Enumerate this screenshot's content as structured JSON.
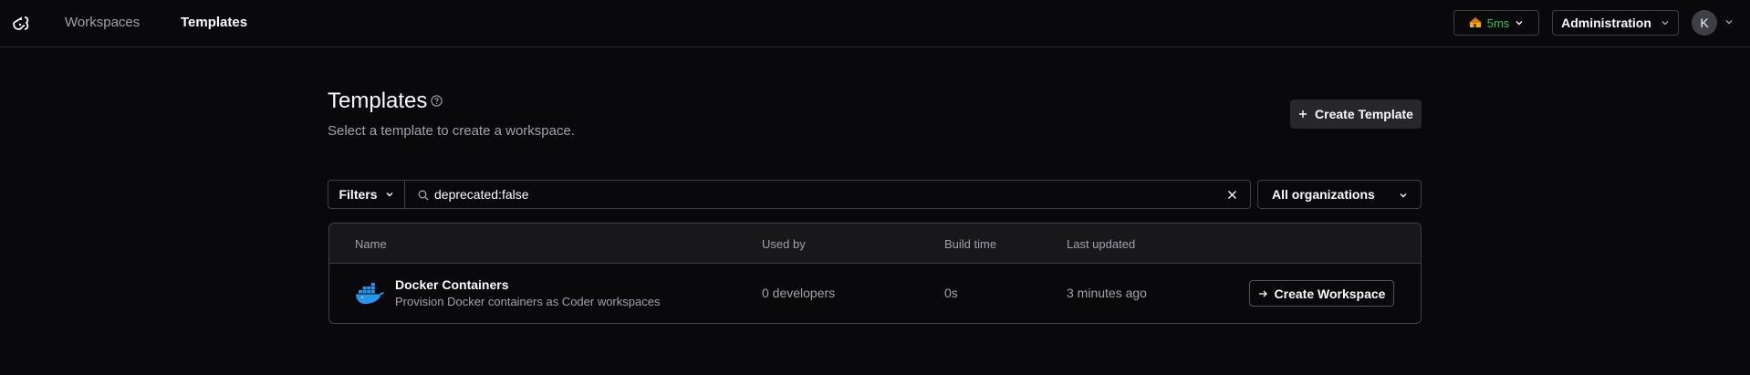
{
  "nav": {
    "logo": "coder-logo",
    "workspaces": "Workspaces",
    "templates": "Templates",
    "latency": "5ms",
    "administration": "Administration",
    "avatar_initial": "K"
  },
  "header": {
    "title": "Templates",
    "subtitle": "Select a template to create a workspace.",
    "create_button": "Create Template"
  },
  "filter": {
    "filters_label": "Filters",
    "search_value": "deprecated:false",
    "org_select": "All organizations"
  },
  "table": {
    "columns": [
      "Name",
      "Used by",
      "Build time",
      "Last updated"
    ],
    "rows": [
      {
        "icon": "docker-icon",
        "name": "Docker Containers",
        "description": "Provision Docker containers as Coder workspaces",
        "used_by": "0 developers",
        "build_time": "0s",
        "last_updated": "3 minutes ago",
        "action": "Create Workspace"
      }
    ]
  },
  "colors": {
    "background": "#09090b",
    "latency_green": "#22c55e",
    "docker_blue": "#2496ed"
  }
}
